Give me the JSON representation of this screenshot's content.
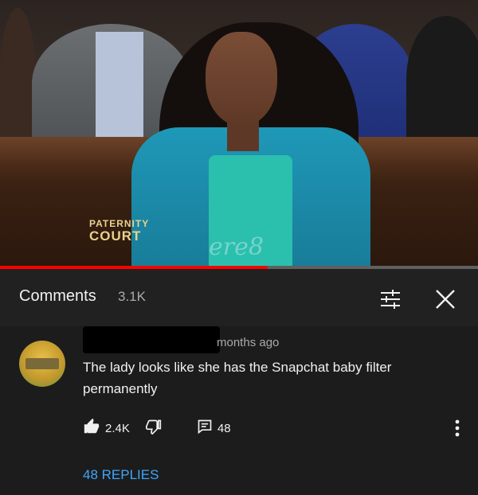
{
  "video": {
    "show_logo_line1": "PATERNITY",
    "show_logo_line2": "COURT",
    "watermark": "ere8",
    "progress": 0.56
  },
  "comments_panel": {
    "title": "Comments",
    "count": "3.1K",
    "icons": [
      "sort-filter-icon",
      "close-icon"
    ]
  },
  "comment": {
    "time": "months ago",
    "text": "The lady looks like she has the Snapchat baby filter permanently",
    "likes": "2.4K",
    "reply_count": "48",
    "replies_link": "48 REPLIES",
    "icons": [
      "thumbs-up-icon",
      "thumbs-down-icon",
      "reply-icon",
      "more-vert-icon"
    ]
  },
  "colors": {
    "background": "#212121",
    "link": "#3ea6ff",
    "progress": "#ff0000",
    "logo": "#e8d28a"
  }
}
